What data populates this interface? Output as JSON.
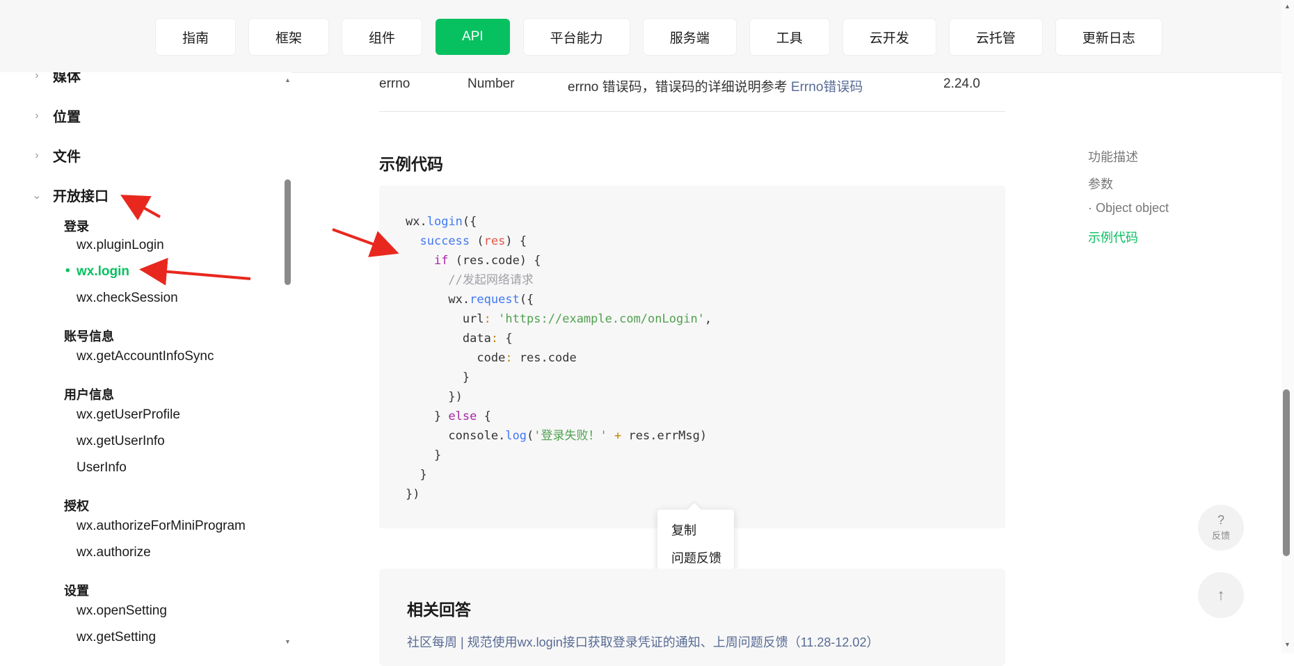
{
  "nav": {
    "tabs": [
      {
        "label": "指南"
      },
      {
        "label": "框架"
      },
      {
        "label": "组件"
      },
      {
        "label": "API"
      },
      {
        "label": "平台能力"
      },
      {
        "label": "服务端"
      },
      {
        "label": "工具"
      },
      {
        "label": "云开发"
      },
      {
        "label": "云托管"
      },
      {
        "label": "更新日志"
      }
    ],
    "active": "API",
    "accent_color": "#07c160"
  },
  "sidebar": {
    "categories": [
      {
        "label": "媒体"
      },
      {
        "label": "位置"
      },
      {
        "label": "文件"
      },
      {
        "label": "开放接口"
      }
    ],
    "groups": [
      {
        "title": "登录",
        "items": [
          "wx.pluginLogin",
          "wx.login",
          "wx.checkSession"
        ]
      },
      {
        "title": "账号信息",
        "items": [
          "wx.getAccountInfoSync"
        ]
      },
      {
        "title": "用户信息",
        "items": [
          "wx.getUserProfile",
          "wx.getUserInfo",
          "UserInfo"
        ]
      },
      {
        "title": "授权",
        "items": [
          "wx.authorizeForMiniProgram",
          "wx.authorize"
        ]
      },
      {
        "title": "设置",
        "items": [
          "wx.openSetting",
          "wx.getSetting"
        ]
      }
    ],
    "active_item": "wx.login"
  },
  "table_row": {
    "name": "errno",
    "type": "Number",
    "desc": "errno 错误码，错误码的详细说明参考 ",
    "desc_link": "Errno错误码",
    "version": "2.24.0"
  },
  "example": {
    "heading": "示例代码",
    "code": {
      "l1_obj": "wx",
      "l1_fn": "login",
      "l2_prop": "success",
      "l2_param": "res",
      "l3_kw": "if",
      "l3_cond": "(res.code)",
      "l4_comment": "//发起网络请求",
      "l5_fn": "request",
      "l6_key": "url",
      "l6_val": "'https://example.com/onLogin'",
      "l7_key": "data",
      "l8_key": "code",
      "l8_val": "res.code",
      "l12_kw": "else",
      "l13_obj": "console",
      "l13_fn": "log",
      "l13_str": "'登录失败！'",
      "l13_rest": "res.errMsg"
    }
  },
  "context_menu": {
    "items": [
      "复制",
      "问题反馈"
    ]
  },
  "related": {
    "heading": "相关回答",
    "link": "社区每周 | 规范使用wx.login接口获取登录凭证的通知、上周问题反馈（11.28-12.02）"
  },
  "toc": {
    "items": [
      "功能描述",
      "参数",
      "· Object object",
      "示例代码"
    ],
    "active": "示例代码"
  },
  "float": {
    "feedback_symbol": "?",
    "feedback_label": "反馈",
    "top_symbol": "↑"
  }
}
